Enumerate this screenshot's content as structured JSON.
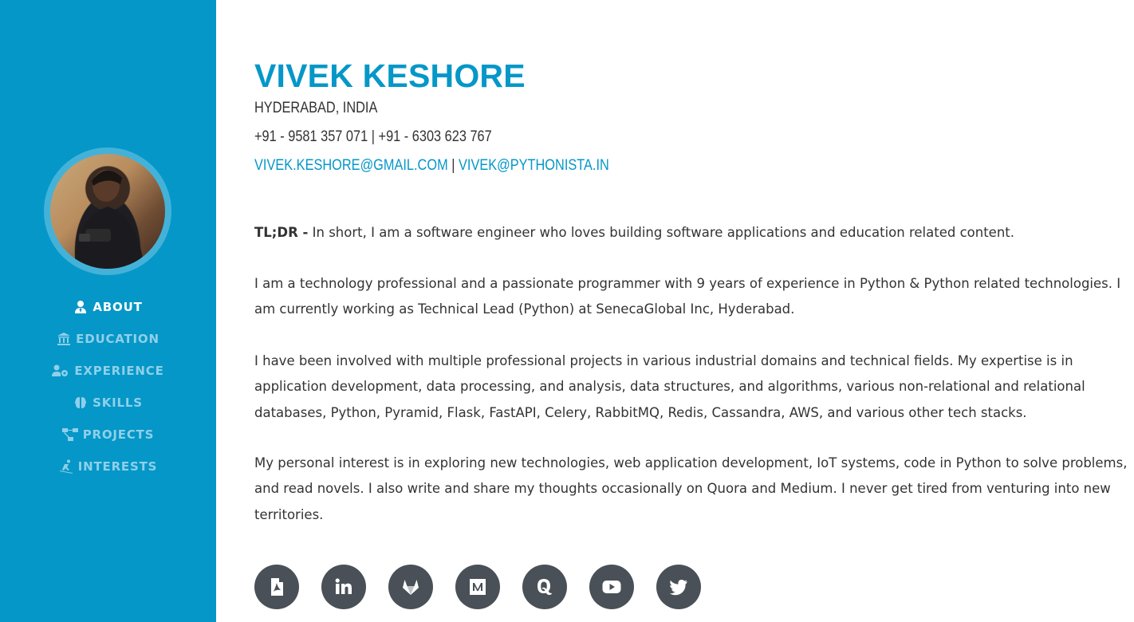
{
  "profile": {
    "name": "VIVEK KESHORE",
    "location": "HYDERABAD, INDIA",
    "phone_1": "+91 - 9581 357 071",
    "phone_sep": " | ",
    "phone_2": "+91 - 6303 623 767",
    "email_1": "VIVEK.KESHORE@GMAIL.COM",
    "email_sep": " | ",
    "email_2": "VIVEK@PYTHONISTA.IN"
  },
  "nav": {
    "items": [
      {
        "label": "ABOUT",
        "icon": "user-tie-icon",
        "active": true
      },
      {
        "label": "EDUCATION",
        "icon": "university-icon",
        "active": false
      },
      {
        "label": "EXPERIENCE",
        "icon": "users-cog-icon",
        "active": false
      },
      {
        "label": "SKILLS",
        "icon": "brain-icon",
        "active": false
      },
      {
        "label": "PROJECTS",
        "icon": "project-diagram-icon",
        "active": false
      },
      {
        "label": "INTERESTS",
        "icon": "skiing-icon",
        "active": false
      }
    ]
  },
  "about": {
    "tldr_label": "TL;DR -",
    "tldr_text": " In short, I am a software engineer who loves building software applications and education related content.",
    "paragraph_2": "I am a technology professional and a passionate programmer with 9 years of experience in Python & Python related technologies. I am currently working as Technical Lead (Python) at SenecaGlobal Inc, Hyderabad.",
    "paragraph_3": "I have been involved with multiple professional projects in various industrial domains and technical fields. My expertise is in application development, data processing, and analysis, data structures, and algorithms, various non-relational and relational databases, Python, Pyramid, Flask, FastAPI, Celery, RabbitMQ, Redis, Cassandra, AWS, and various other tech stacks.",
    "paragraph_4": "My personal interest is in exploring new technologies, web application development, IoT systems, code in Python to solve problems, and read novels. I also write and share my thoughts occasionally on Quora and Medium. I never get tired from venturing into new territories."
  },
  "socials": [
    "pdf-icon",
    "linkedin-icon",
    "gitlab-icon",
    "medium-icon",
    "quora-icon",
    "youtube-icon",
    "twitter-icon"
  ],
  "colors": {
    "sidebar": "#0597c8",
    "accent": "#0597c8",
    "nav_inactive": "#8fd0e9",
    "social_bg": "#495057"
  }
}
